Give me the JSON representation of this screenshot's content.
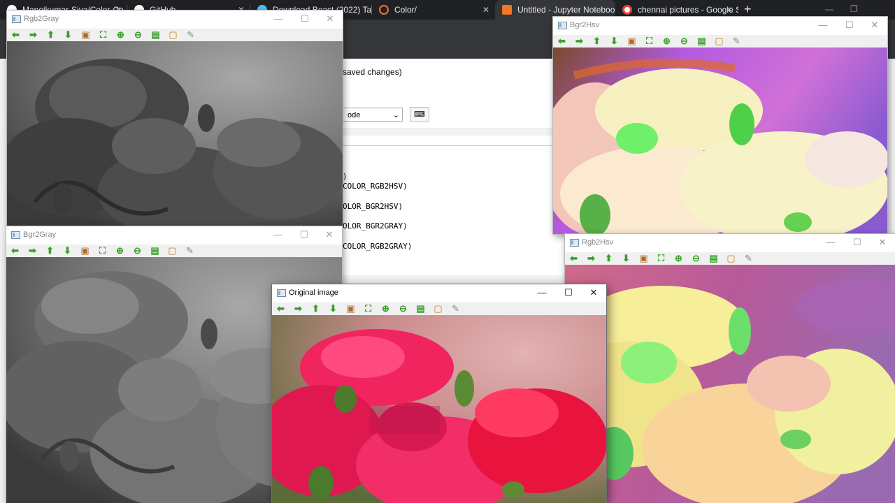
{
  "browser": {
    "tabs": [
      {
        "title": "Manoikumar-Siva/Color-Co",
        "icon": "github-icon",
        "color": "#ffffff"
      },
      {
        "title": "GitHub",
        "icon": "github-icon",
        "color": "#ffffff"
      },
      {
        "title": "Download Beast (2022) Tam",
        "icon": "globe-icon",
        "color": "#4fc3f7"
      },
      {
        "title": "Color/",
        "icon": "jupyter-icon",
        "color": "#f37626"
      },
      {
        "title": "Untitled - Jupyter Noteboo",
        "icon": "hourglass-icon",
        "color": "#f37626"
      },
      {
        "title": "chennai pictures - Google S",
        "icon": "google-icon",
        "color": "#ea4335"
      }
    ],
    "new_tab": "+"
  },
  "jupyter": {
    "saved_status": "saved changes)",
    "cell_type": "ode",
    "code_lines": [
      ")",
      "COLOR_RGB2HSV)",
      "",
      "OLOR_BGR2HSV)",
      "",
      "OLOR_BGR2GRAY)",
      "",
      "COLOR_RGB2GRAY)"
    ]
  },
  "windows": {
    "rgb2gray": {
      "title": "Rgb2Gray"
    },
    "bgr2gray": {
      "title": "Bgr2Gray"
    },
    "bgr2hsv": {
      "title": "Bgr2Hsv"
    },
    "rgb2hsv": {
      "title": "Rgb2Hsv"
    },
    "original": {
      "title": "Original image"
    }
  },
  "window_buttons": {
    "minimize": "—",
    "maximize": "☐",
    "close": "✕"
  },
  "cv_toolbar": [
    {
      "name": "pan-left-icon",
      "glyph": "⬅"
    },
    {
      "name": "pan-right-icon",
      "glyph": "➡"
    },
    {
      "name": "pan-up-icon",
      "glyph": "⬆"
    },
    {
      "name": "pan-down-icon",
      "glyph": "⬇"
    },
    {
      "name": "zoom-original-icon",
      "glyph": "▣"
    },
    {
      "name": "zoom-fit-icon",
      "glyph": "⛶"
    },
    {
      "name": "zoom-in-icon",
      "glyph": "⊕"
    },
    {
      "name": "zoom-out-icon",
      "glyph": "⊖"
    },
    {
      "name": "save-icon",
      "glyph": "▤"
    },
    {
      "name": "properties-icon",
      "glyph": "▢"
    },
    {
      "name": "settings-icon",
      "glyph": "✎"
    }
  ],
  "palette": {
    "gray_bg": "#6e6e6e",
    "gray_petal": "#4a4a4a",
    "hsv_bg": "#b45ae0",
    "hsv_petal": "#f7f2c8",
    "rose_pink": "#f0245f",
    "rose_bg": "#c98b8c",
    "leaf_green": "#4e7a2e"
  }
}
